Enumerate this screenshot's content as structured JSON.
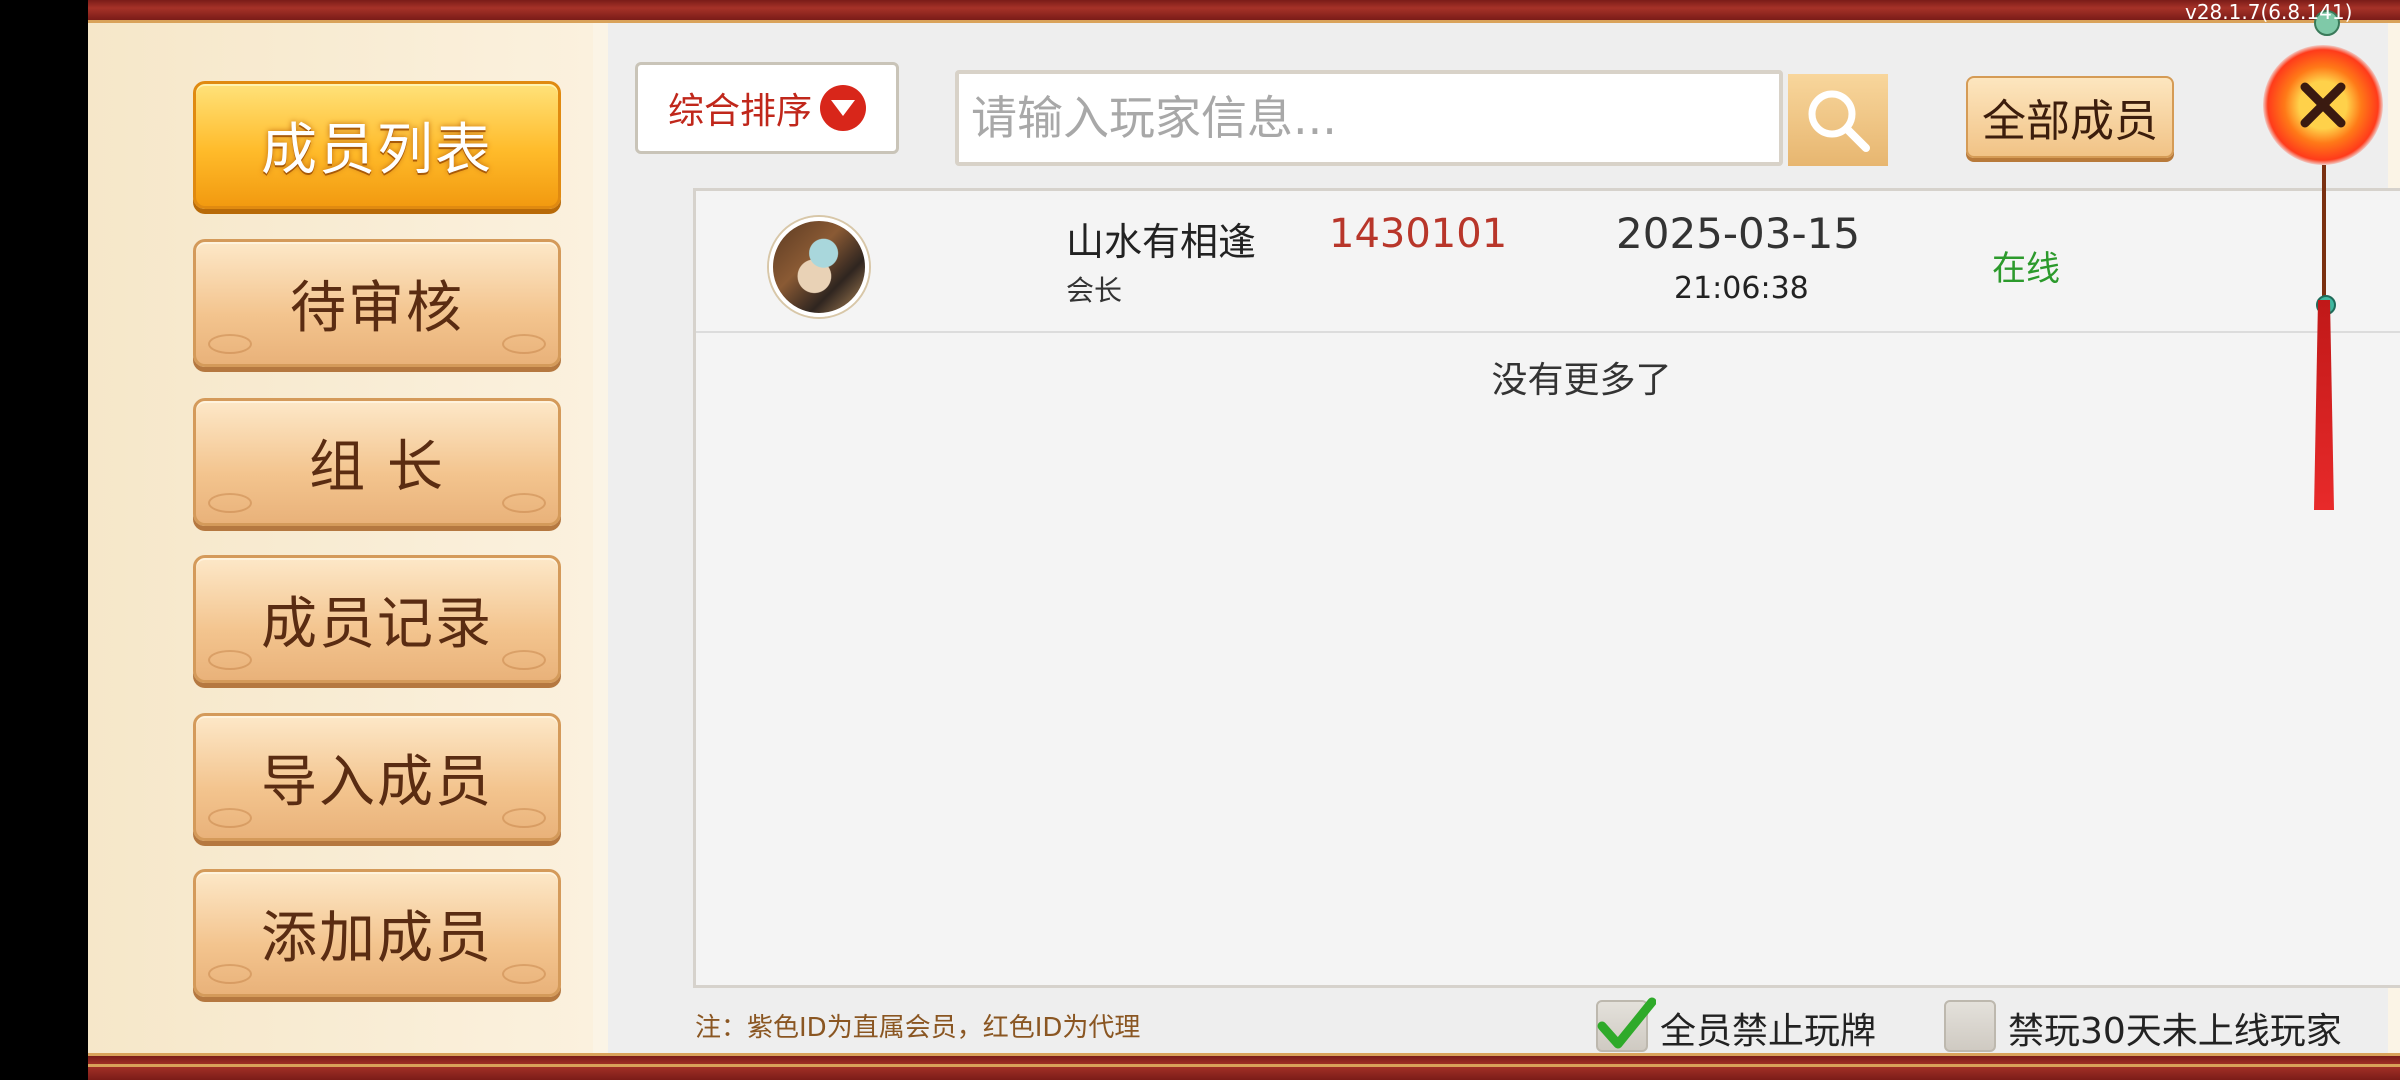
{
  "version": "v28.1.7(6.8.141)",
  "sidebar": {
    "items": [
      {
        "label": "成员列表",
        "active": true
      },
      {
        "label": "待审核",
        "active": false
      },
      {
        "label": "组 长",
        "active": false
      },
      {
        "label": "成员记录",
        "active": false
      },
      {
        "label": "导入成员",
        "active": false
      },
      {
        "label": "添加成员",
        "active": false
      }
    ]
  },
  "toolbar": {
    "sort_label": "综合排序",
    "search_placeholder": "请输入玩家信息...",
    "filter_label": "全部成员"
  },
  "members": [
    {
      "name": "山水有相逢",
      "role": "会长",
      "id": "1430101",
      "date": "2025-03-15",
      "time": "21:06:38",
      "status": "在线"
    }
  ],
  "list_end_text": "没有更多了",
  "footer": {
    "note": "注：紫色ID为直属会员，红色ID为代理",
    "option1": {
      "label": "全员禁止玩牌",
      "checked": true
    },
    "option2": {
      "label": "禁玩30天未上线玩家",
      "checked": false
    }
  },
  "colors": {
    "accent_red": "#b8362a",
    "online_green": "#2c9a2c",
    "active_tab": "#ffbb2a"
  },
  "icons": {
    "sort": "triangle-down-icon",
    "search": "magnifier-icon",
    "close": "close-icon",
    "check": "check-icon"
  }
}
